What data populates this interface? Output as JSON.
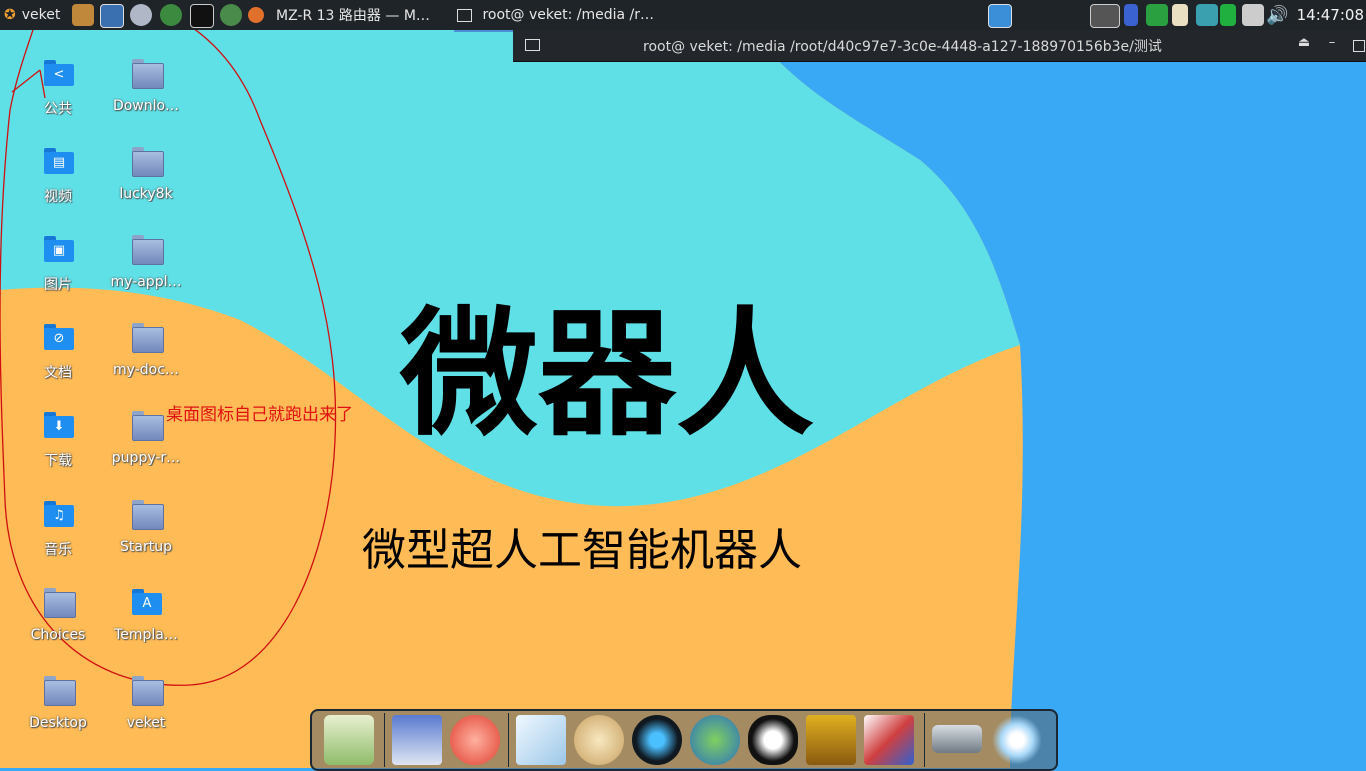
{
  "taskbar": {
    "menu_label": "veket",
    "tasks": [
      {
        "label": "MZ-R 13 路由器 — M…"
      },
      {
        "label": "root@ veket: /media /r…"
      }
    ],
    "clock": "14:47:08"
  },
  "terminal": {
    "title": "root@ veket: /media /root/d40c97e7-3c0e-4448-a127-188970156b3e/测试",
    "eject_btn": "⏏",
    "min_btn": "–"
  },
  "desktop_icons": [
    {
      "label": "公共",
      "icon": "share-folder-icon"
    },
    {
      "label": "Downlo…",
      "icon": "folder-icon"
    },
    {
      "label": "视频",
      "icon": "video-folder-icon"
    },
    {
      "label": "lucky8k",
      "icon": "folder-icon"
    },
    {
      "label": "图片",
      "icon": "pictures-folder-icon"
    },
    {
      "label": "my-appl…",
      "icon": "folder-icon"
    },
    {
      "label": "文档",
      "icon": "documents-folder-icon"
    },
    {
      "label": "my-doc…",
      "icon": "folder-icon"
    },
    {
      "label": "下载",
      "icon": "download-folder-icon"
    },
    {
      "label": "puppy-r…",
      "icon": "folder-icon"
    },
    {
      "label": "音乐",
      "icon": "music-folder-icon"
    },
    {
      "label": "Startup",
      "icon": "folder-icon"
    },
    {
      "label": "Choices",
      "icon": "folder-icon"
    },
    {
      "label": "Templa…",
      "icon": "templates-folder-icon"
    },
    {
      "label": "Desktop",
      "icon": "folder-icon"
    },
    {
      "label": "veket",
      "icon": "folder-icon"
    }
  ],
  "wallpaper": {
    "title": "微器人",
    "subtitle": "微型超人工智能机器人",
    "colors": {
      "blue": "#3aa9f5",
      "cyan": "#5fe0e6",
      "orange": "#ffbb55"
    }
  },
  "annotation": "桌面图标自己就跑出来了",
  "dock": {
    "apps": [
      "file-manager-icon",
      "monitor-icon",
      "cat-icon",
      "writer-icon",
      "paint-icon",
      "media-player-icon",
      "users-icon",
      "tux-penguin-icon",
      "notebook-icon",
      "chart-icon",
      "drive-icon",
      "settings-sun-icon"
    ]
  }
}
